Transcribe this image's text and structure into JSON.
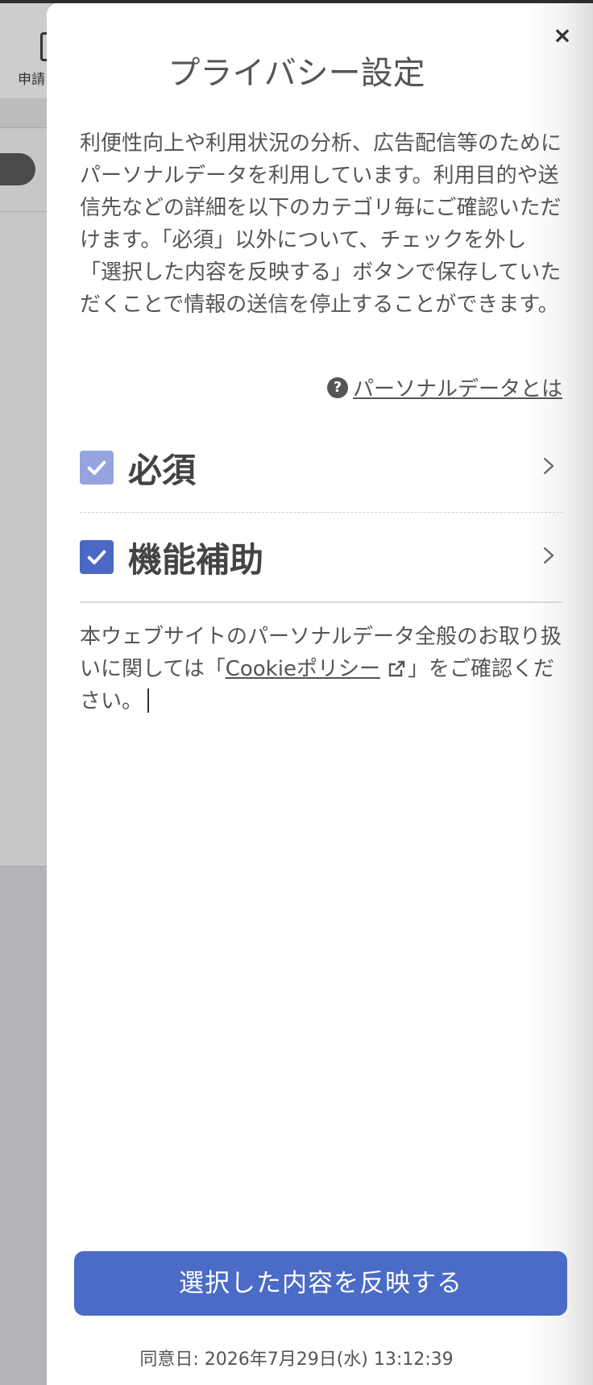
{
  "background": {
    "toolbar_label": "申請"
  },
  "dialog": {
    "title": "プライバシー設定",
    "close_label": "×",
    "description": "利便性向上や利用状況の分析、広告配信等のためにパーソナルデータを利用しています。利用目的や送信先などの詳細を以下のカテゴリ毎にご確認いただけます。「必須」以外について、チェックを外し「選択した内容を反映する」ボタンで保存していただくことで情報の送信を停止することができます。",
    "help_icon_glyph": "?",
    "help_link": "パーソナルデータとは",
    "categories": [
      {
        "label": "必須",
        "checked": true,
        "disabled": true
      },
      {
        "label": "機能補助",
        "checked": true,
        "disabled": false
      }
    ],
    "policy_prefix": "本ウェブサイトのパーソナルデータ全般のお取り扱いに関しては「",
    "policy_link": "Cookieポリシー",
    "policy_suffix": "」をご確認ください。",
    "apply_button": "選択した内容を反映する",
    "consent_date": "同意日: 2026年7月29日(水) 13:12:39"
  },
  "colors": {
    "accent": "#4a6bc6",
    "checkbox_disabled": "#95a4de",
    "text": "#555555"
  }
}
